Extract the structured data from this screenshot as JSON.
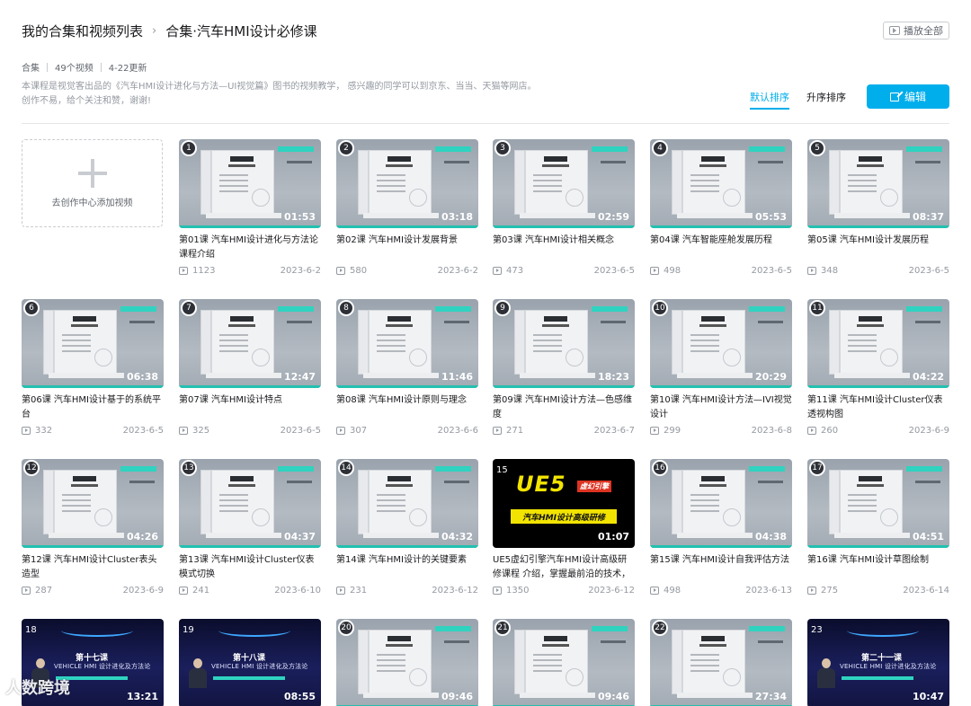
{
  "header": {
    "root": "我的合集和视频列表",
    "separator": "›",
    "current": "合集·汽车HMI设计必修课",
    "play_all": "播放全部"
  },
  "meta": {
    "type": "合集",
    "count": "49个视频",
    "updated": "4-22更新"
  },
  "description": {
    "line1": "本课程是视觉客出品的《汽车HMI设计进化与方法—UI视觉篇》图书的视频教学， 感兴趣的同学可以到京东、当当、天猫等网店。",
    "line2": "创作不易，给个关注和赞，谢谢!"
  },
  "sort": {
    "default": "默认排序",
    "asc": "升序排序"
  },
  "edit": {
    "label": "编辑"
  },
  "add_video": {
    "label": "去创作中心添加视频"
  },
  "videos": [
    {
      "num": "1",
      "duration": "01:53",
      "title": "第01课 汽车HMI设计进化与方法论课程介绍",
      "views": "1123",
      "date": "2023-6-2",
      "style": "book"
    },
    {
      "num": "2",
      "duration": "03:18",
      "title": "第02课 汽车HMI设计发展背景",
      "views": "580",
      "date": "2023-6-2",
      "style": "book"
    },
    {
      "num": "3",
      "duration": "02:59",
      "title": "第03课 汽车HMI设计相关概念",
      "views": "473",
      "date": "2023-6-5",
      "style": "book"
    },
    {
      "num": "4",
      "duration": "05:53",
      "title": "第04课 汽车智能座舱发展历程",
      "views": "498",
      "date": "2023-6-5",
      "style": "book"
    },
    {
      "num": "5",
      "duration": "08:37",
      "title": "第05课 汽车HMI设计发展历程",
      "views": "348",
      "date": "2023-6-5",
      "style": "book"
    },
    {
      "num": "6",
      "duration": "06:38",
      "title": "第06课 汽车HMI设计基于的系统平台",
      "views": "332",
      "date": "2023-6-5",
      "style": "book"
    },
    {
      "num": "7",
      "duration": "12:47",
      "title": "第07课 汽车HMI设计特点",
      "views": "325",
      "date": "2023-6-5",
      "style": "book"
    },
    {
      "num": "8",
      "duration": "11:46",
      "title": "第08课 汽车HMI设计原则与理念",
      "views": "307",
      "date": "2023-6-6",
      "style": "book"
    },
    {
      "num": "9",
      "duration": "18:23",
      "title": "第09课 汽车HMI设计方法—色感维度",
      "views": "271",
      "date": "2023-6-7",
      "style": "book"
    },
    {
      "num": "10",
      "duration": "20:29",
      "title": "第10课 汽车HMI设计方法—IVI视觉设计",
      "views": "299",
      "date": "2023-6-8",
      "style": "book"
    },
    {
      "num": "11",
      "duration": "04:22",
      "title": "第11课 汽车HMI设计Cluster仪表透视构图",
      "views": "260",
      "date": "2023-6-9",
      "style": "book"
    },
    {
      "num": "12",
      "duration": "04:26",
      "title": "第12课 汽车HMI设计Cluster表头造型",
      "views": "287",
      "date": "2023-6-9",
      "style": "book"
    },
    {
      "num": "13",
      "duration": "04:37",
      "title": "第13课 汽车HMI设计Cluster仪表模式切换",
      "views": "241",
      "date": "2023-6-10",
      "style": "book"
    },
    {
      "num": "14",
      "duration": "04:32",
      "title": "第14课 汽车HMI设计的关键要素",
      "views": "231",
      "date": "2023-6-12",
      "style": "book"
    },
    {
      "num": "15",
      "duration": "01:07",
      "title": "UE5虚幻引擎汽车HMI设计高级研修课程 介绍，掌握最前沿的技术，工",
      "views": "1350",
      "date": "2023-6-12",
      "style": "ue5"
    },
    {
      "num": "16",
      "duration": "04:38",
      "title": "第15课 汽车HMI设计自我评估方法",
      "views": "498",
      "date": "2023-6-13",
      "style": "book"
    },
    {
      "num": "17",
      "duration": "04:51",
      "title": "第16课 汽车HMI设计草图绘制",
      "views": "275",
      "date": "2023-6-14",
      "style": "book"
    },
    {
      "num": "18",
      "duration": "13:21",
      "title": "",
      "views": "",
      "date": "",
      "style": "dark",
      "lesson": "第十七课"
    },
    {
      "num": "19",
      "duration": "08:55",
      "title": "",
      "views": "",
      "date": "",
      "style": "dark",
      "lesson": "第十八课"
    },
    {
      "num": "20",
      "duration": "09:46",
      "title": "",
      "views": "",
      "date": "",
      "style": "book"
    },
    {
      "num": "21",
      "duration": "09:46",
      "title": "",
      "views": "",
      "date": "",
      "style": "book"
    },
    {
      "num": "22",
      "duration": "27:34",
      "title": "",
      "views": "",
      "date": "",
      "style": "book"
    },
    {
      "num": "23",
      "duration": "10:47",
      "title": "",
      "views": "",
      "date": "",
      "style": "dark",
      "lesson": "第二十一课"
    }
  ],
  "ue5": {
    "title": "UE5",
    "sub": "虚幻引擎",
    "band": "汽车HMI设计高级研修"
  },
  "dark_eng": "VEHICLE HMI 设计进化及方法论",
  "watermark": "人数跨境",
  "colors": {
    "accent": "#00aeec",
    "teal": "#22c1b0"
  }
}
